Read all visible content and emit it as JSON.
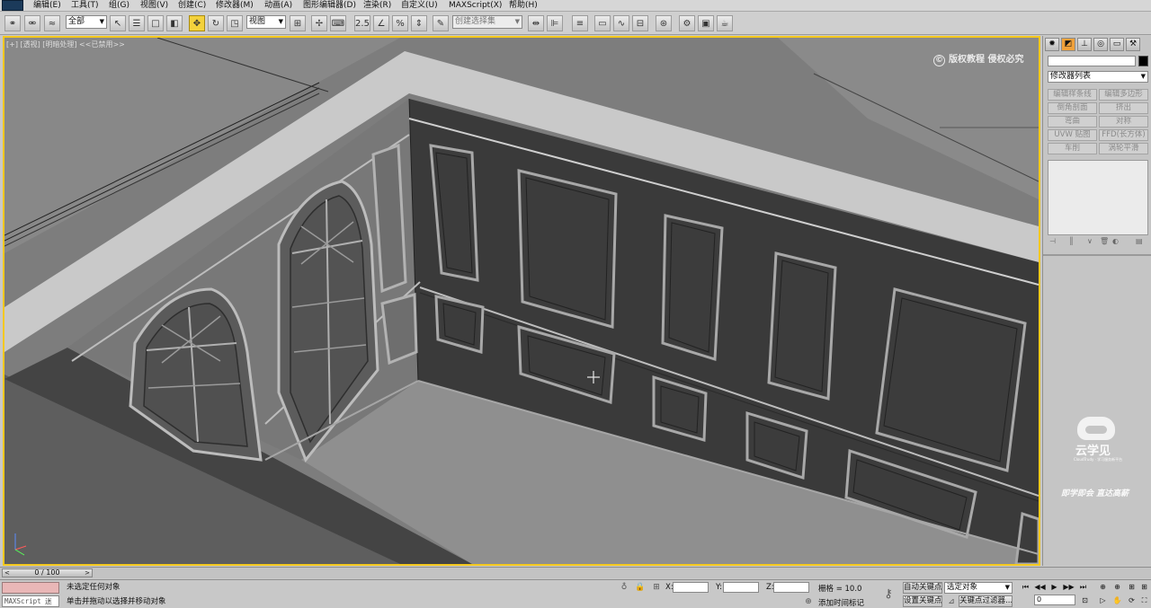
{
  "menu": {
    "items": [
      "编辑(E)",
      "工具(T)",
      "组(G)",
      "视图(V)",
      "创建(C)",
      "修改器(M)",
      "动画(A)",
      "图形编辑器(D)",
      "渲染(R)",
      "自定义(U)",
      "MAXScript(X)",
      "帮助(H)"
    ]
  },
  "toolbar": {
    "selection_filter": "全部",
    "ref_coord": "视图",
    "named_selection_set": "创建选择集",
    "icons": [
      "link-icon",
      "unlink-icon",
      "bind-spacewarp-icon",
      "select-object-icon",
      "select-by-name-icon",
      "rect-selection-icon",
      "window-crossing-icon",
      "move-icon",
      "rotate-icon",
      "scale-icon",
      "pivot-icon",
      "select-manipulate-icon",
      "snap-icon",
      "angle-snap-icon",
      "percent-snap-icon",
      "spinner-snap-icon",
      "edit-named-sets-icon",
      "mirror-icon",
      "align-icon",
      "layer-manager-icon",
      "graphite-icon",
      "curve-editor-icon",
      "schematic-icon",
      "material-editor-icon",
      "render-setup-icon",
      "rendered-frame-icon",
      "render-icon"
    ]
  },
  "viewport": {
    "label": "[+] [透视] [明暗处理] <<已禁用>>",
    "watermark_copyright": "版权教程 侵权必究"
  },
  "command_panel": {
    "tabs": [
      "create-tab-icon",
      "modify-tab-icon",
      "hierarchy-tab-icon",
      "motion-tab-icon",
      "display-tab-icon",
      "utilities-tab-icon"
    ],
    "modifier_list": "修改器列表",
    "buttons": [
      "编辑样条线",
      "编辑多边形",
      "倒角剖面",
      "挤出",
      "弯曲",
      "对称",
      "UVW 贴图",
      "FFD(长方体)",
      "车削",
      "涡轮平滑"
    ],
    "logo_text": "云学见",
    "logo_sub": "CloudTrudy · 学习服务新平台",
    "slogan": "即学即会  直达高薪"
  },
  "timeslider": {
    "value": "0 / 100",
    "left_arrow": "<",
    "right_arrow": ">"
  },
  "status": {
    "maxscript_label": "MAXScript 迷",
    "selection_status": "未选定任何对象",
    "prompt": "单击并拖动以选择并移动对象",
    "x_label": "X:",
    "y_label": "Y:",
    "z_label": "Z:",
    "grid": "栅格 = 10.0",
    "add_time_tag": "添加时间标记",
    "auto_key": "自动关键点",
    "set_key": "设置关键点",
    "key_mode": "选定对象",
    "key_filters": "关键点过滤器...",
    "frame": "0"
  }
}
